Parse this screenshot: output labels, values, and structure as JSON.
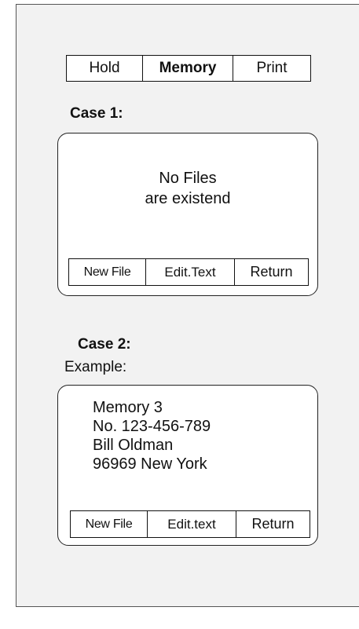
{
  "tabs": {
    "hold": "Hold",
    "memory": "Memory",
    "print": "Print"
  },
  "case1": {
    "title": "Case 1:",
    "message_line1": "No Files",
    "message_line2": "are existend",
    "softkeys": {
      "new_file": "New File",
      "edit_text": "Edit.Text",
      "return": "Return"
    }
  },
  "case2": {
    "title": "Case 2:",
    "example_label": "Example:",
    "record": {
      "line1": "Memory 3",
      "line2": "No. 123-456-789",
      "line3": "Bill Oldman",
      "line4": "96969 New York"
    },
    "softkeys": {
      "new_file": "New File",
      "edit_text": "Edit.text",
      "return": "Return"
    }
  }
}
